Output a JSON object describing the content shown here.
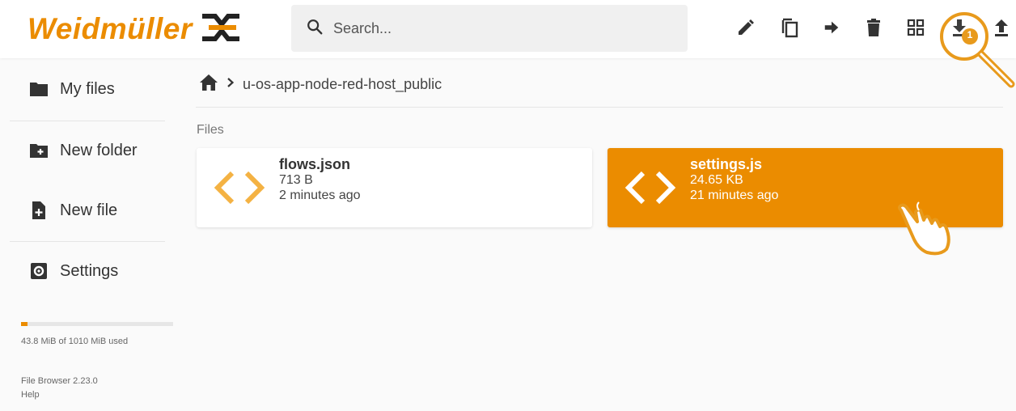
{
  "brand": {
    "name": "Weidmüller",
    "color": "#eb8c00"
  },
  "search": {
    "placeholder": "Search..."
  },
  "toolbar": {
    "actions": [
      {
        "name": "rename",
        "icon": "pencil-icon"
      },
      {
        "name": "copy",
        "icon": "copy-icon"
      },
      {
        "name": "move",
        "icon": "arrow-right-icon"
      },
      {
        "name": "delete",
        "icon": "trash-icon"
      },
      {
        "name": "view",
        "icon": "grid-view-icon"
      },
      {
        "name": "download",
        "icon": "download-icon"
      },
      {
        "name": "upload",
        "icon": "upload-icon"
      }
    ],
    "annotation_badge": "1"
  },
  "sidebar": {
    "items": [
      {
        "label": "My files",
        "icon": "folder-icon"
      },
      {
        "label": "New folder",
        "icon": "folder-plus-icon"
      },
      {
        "label": "New file",
        "icon": "file-plus-icon"
      },
      {
        "label": "Settings",
        "icon": "gear-icon"
      }
    ],
    "usage": {
      "text": "43.8 MiB of 1010 MiB used",
      "fraction": 0.0434
    },
    "footer": {
      "version": "File Browser 2.23.0",
      "help": "Help"
    }
  },
  "breadcrumb": {
    "home_icon": "home-icon",
    "current": "u-os-app-node-red-host_public"
  },
  "files_section": {
    "title": "Files"
  },
  "files": [
    {
      "name": "flows.json",
      "size": "713 B",
      "modified": "2 minutes ago",
      "icon": "code-icon",
      "selected": false
    },
    {
      "name": "settings.js",
      "size": "24.65 KB",
      "modified": "21 minutes ago",
      "icon": "code-icon",
      "selected": true
    }
  ]
}
